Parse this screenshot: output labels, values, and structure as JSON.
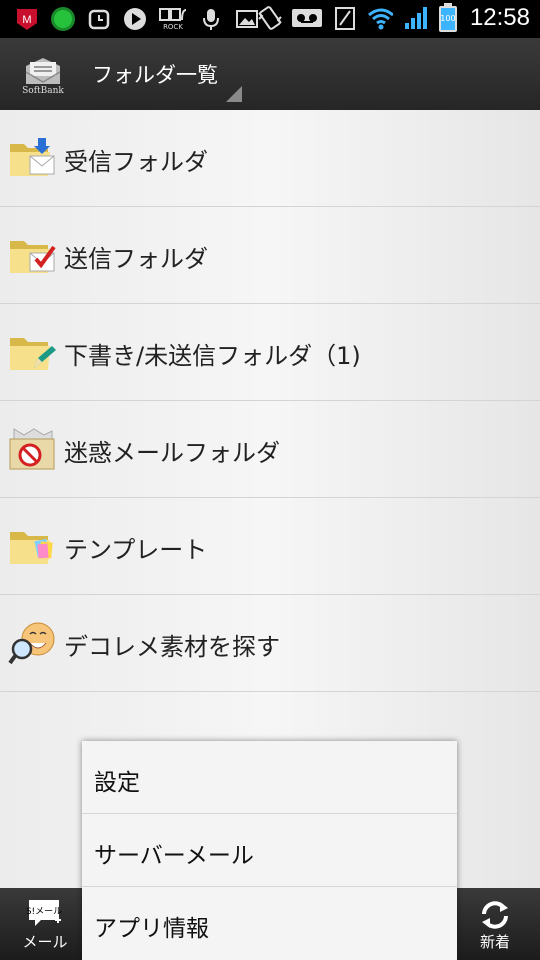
{
  "status_bar": {
    "time": "12:58",
    "left_icons": [
      "mcafee-icon",
      "isw-icon",
      "alarm-icon",
      "play-icon",
      "rock-radio-icon",
      "microphone-icon",
      "image-icon"
    ],
    "right_icons": [
      "vibrate-icon",
      "voicemail-icon",
      "sim-icon",
      "wifi-icon",
      "signal-icon",
      "battery-icon"
    ],
    "rock_label": "ROCK",
    "isw_label": "iSW",
    "battery_label": "100"
  },
  "action_bar": {
    "logo_text": "SoftBank",
    "title": "フォルダ一覧"
  },
  "folders": [
    {
      "label": "受信フォルダ",
      "icon": "inbox-folder-icon"
    },
    {
      "label": "送信フォルダ",
      "icon": "sent-folder-icon"
    },
    {
      "label": "下書き/未送信フォルダ（1)",
      "icon": "drafts-folder-icon"
    },
    {
      "label": "迷惑メールフォルダ",
      "icon": "spam-folder-icon"
    },
    {
      "label": "テンプレート",
      "icon": "template-folder-icon"
    },
    {
      "label": "デコレメ素材を探す",
      "icon": "search-deco-icon"
    }
  ],
  "menu": {
    "items": [
      "設定",
      "サーバーメール",
      "アプリ情報"
    ]
  },
  "bottom_bar": {
    "mail_label": "メール",
    "mail_icon_text": "S!メール",
    "refresh_label": "新着"
  },
  "colors": {
    "status_bar": "#000000",
    "action_bar": "#2e2e2e",
    "list_bg": "#eeeeee",
    "folder_yellow": "#f2d77a"
  }
}
